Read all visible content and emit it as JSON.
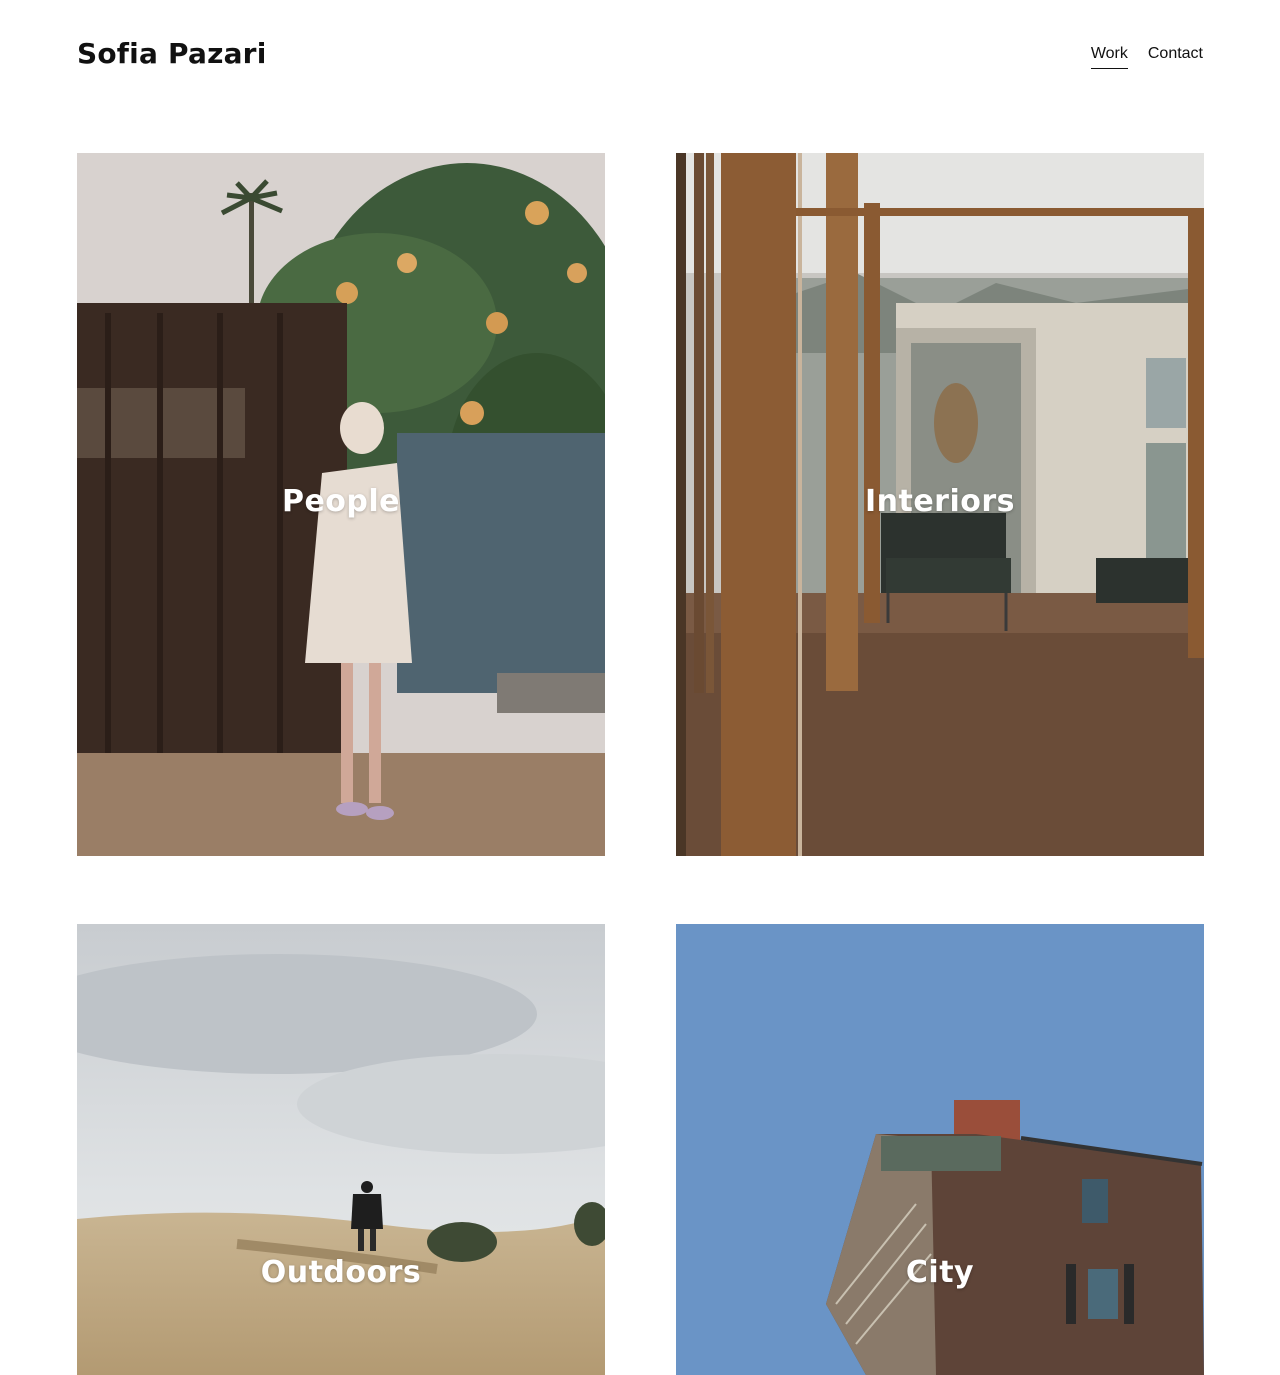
{
  "header": {
    "site_title": "Sofia Pazari",
    "nav": [
      {
        "label": "Work",
        "active": true
      },
      {
        "label": "Contact",
        "active": false
      }
    ]
  },
  "gallery": {
    "tiles": [
      {
        "label": "People",
        "image": "woman-by-flowering-tree-photo"
      },
      {
        "label": "Interiors",
        "image": "wooden-interior-with-chairs-photo"
      },
      {
        "label": "Outdoors",
        "image": "person-walking-in-grass-field-photo"
      },
      {
        "label": "City",
        "image": "brick-building-against-blue-sky-photo"
      }
    ]
  },
  "colors": {
    "text": "#111111",
    "background": "#ffffff",
    "tile_label": "#ffffff"
  }
}
